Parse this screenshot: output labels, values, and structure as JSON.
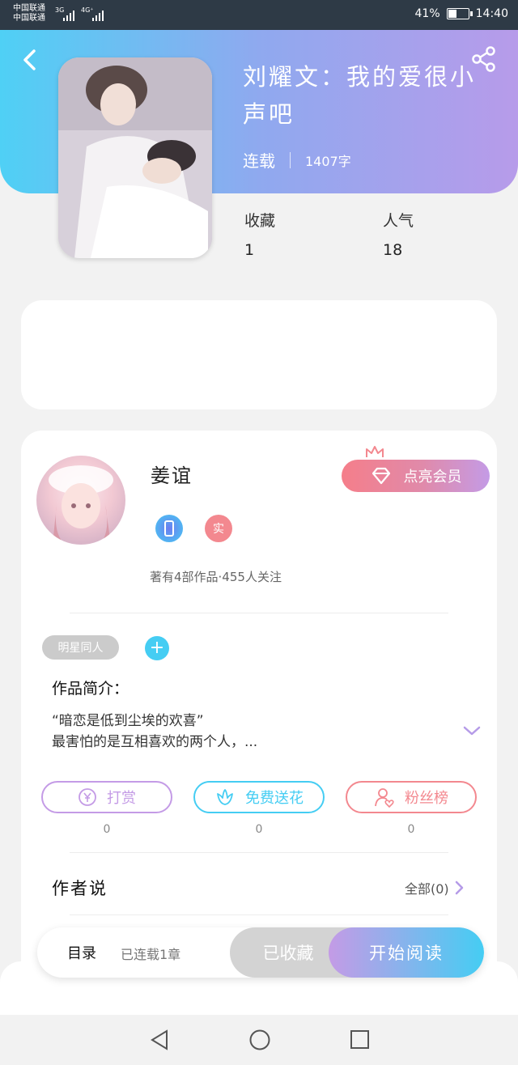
{
  "status_bar": {
    "carrier_1": "中国联通",
    "carrier_2": "中国联通",
    "network_1": "3G",
    "network_2": "4G⁺",
    "battery": "41%",
    "battery_level": 0.41,
    "time": "14:40"
  },
  "book": {
    "title": "刘耀文：我的爱很小声吧",
    "status": "连载",
    "word_count": "1407字",
    "favorites_label": "收藏",
    "favorites_value": "1",
    "popularity_label": "人气",
    "popularity_value": "18"
  },
  "author": {
    "name": "姜谊",
    "real_badge": "实",
    "vip_button": "点亮会员",
    "stats": "著有4部作品·455人关注",
    "tag": "明星同人",
    "tag_add": "+"
  },
  "intro": {
    "heading": "作品简介：",
    "line1": "“暗恋是低到尘埃的欢喜”",
    "line2": "最害怕的是互相喜欢的两个人，..."
  },
  "actions": [
    {
      "label": "打赏",
      "count": "0",
      "icon": "yen-coin-icon",
      "color": "#c49be6"
    },
    {
      "label": "免费送花",
      "count": "0",
      "icon": "flower-icon",
      "color": "#45cdf3"
    },
    {
      "label": "粉丝榜",
      "count": "0",
      "icon": "user-heart-icon",
      "color": "#f3888f"
    }
  ],
  "author_says": {
    "heading": "作者说",
    "all_link": "全部(0)"
  },
  "bottom_bar": {
    "catalog": "目录",
    "chapters": "已连载1章",
    "collected": "已收藏",
    "start_read": "开始阅读"
  },
  "colors": {
    "header_gradient_start": "#4fd0f5",
    "header_gradient_end": "#b79bea",
    "accent_blue": "#45cdf3",
    "accent_purple": "#c49be6",
    "accent_pink": "#f3888f"
  }
}
